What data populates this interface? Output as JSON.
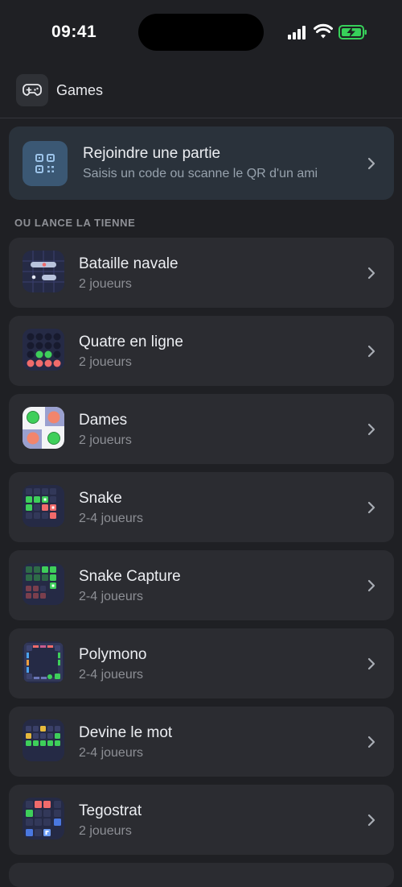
{
  "status_bar": {
    "time": "09:41"
  },
  "header": {
    "title": "Games",
    "icon": "gamepad-icon"
  },
  "join": {
    "title": "Rejoindre une partie",
    "subtitle": "Saisis un code ou scanne le QR d'un ami",
    "icon": "qr-code-icon"
  },
  "section_label": "OU LANCE LA TIENNE",
  "games": [
    {
      "name": "Bataille navale",
      "players": "2 joueurs",
      "icon": "battleship-icon"
    },
    {
      "name": "Quatre en ligne",
      "players": "2 joueurs",
      "icon": "connect-four-icon"
    },
    {
      "name": "Dames",
      "players": "2 joueurs",
      "icon": "checkers-icon"
    },
    {
      "name": "Snake",
      "players": "2-4 joueurs",
      "icon": "snake-icon"
    },
    {
      "name": "Snake Capture",
      "players": "2-4 joueurs",
      "icon": "snake-capture-icon"
    },
    {
      "name": "Polymono",
      "players": "2-4 joueurs",
      "icon": "polymono-icon"
    },
    {
      "name": "Devine le mot",
      "players": "2-4 joueurs",
      "icon": "word-guess-icon"
    },
    {
      "name": "Tegostrat",
      "players": "2 joueurs",
      "icon": "tegostrat-icon"
    }
  ],
  "colors": {
    "background": "#1f2024",
    "card": "#2b2c31",
    "join_card": "#2a323b",
    "accent_blue": "#3b5874",
    "green": "#3ecf5a",
    "red": "#f06b6b",
    "battery_green": "#37d05a"
  }
}
